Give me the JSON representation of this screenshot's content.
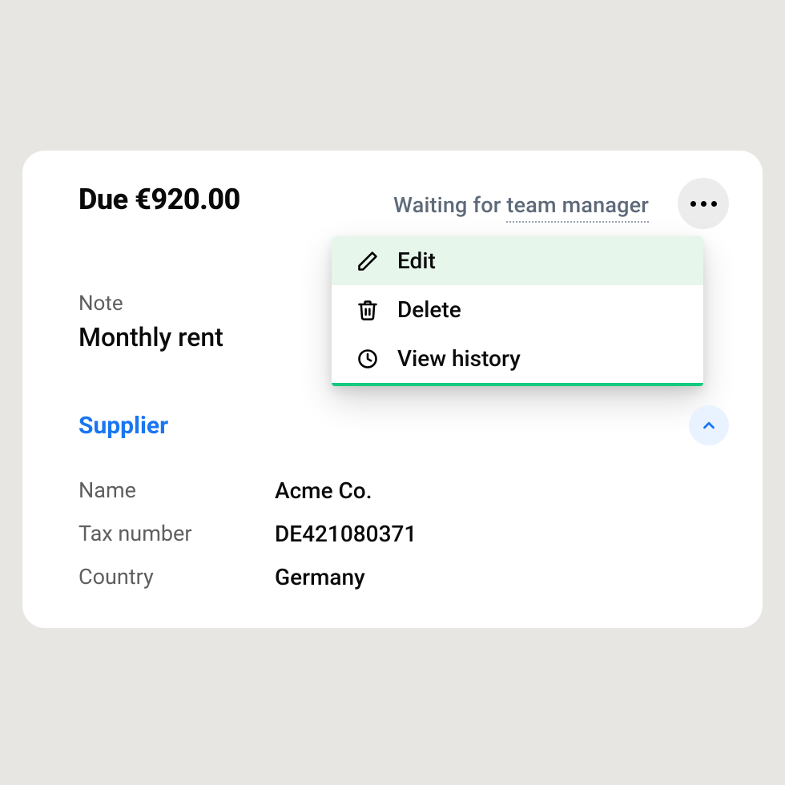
{
  "header": {
    "due_text": "Due €920.00",
    "status_prefix": "Waiting for ",
    "status_link": "team manager"
  },
  "menu": {
    "edit": "Edit",
    "delete": "Delete",
    "view_history": "View history"
  },
  "note": {
    "label": "Note",
    "value": "Monthly rent"
  },
  "supplier": {
    "section_title": "Supplier",
    "name_label": "Name",
    "name_value": "Acme Co.",
    "tax_label": "Tax number",
    "tax_value": "DE421080371",
    "country_label": "Country",
    "country_value": "Germany"
  },
  "colors": {
    "accent_blue": "#1976f2",
    "accent_green": "#14c97c",
    "bg": "#e7e6e3"
  }
}
